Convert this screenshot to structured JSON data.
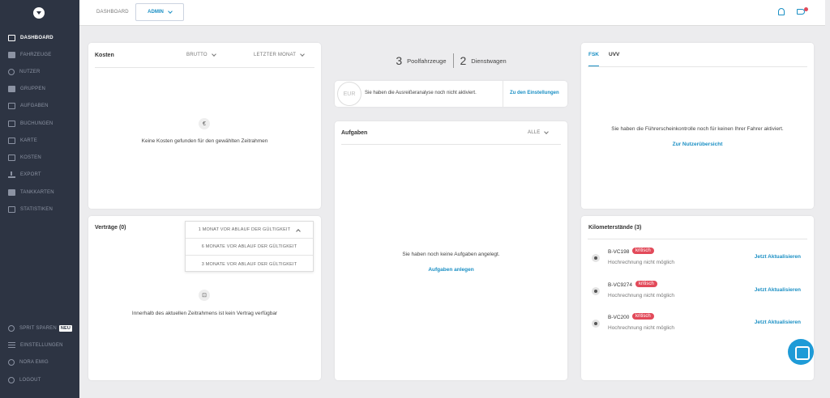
{
  "sidebar": {
    "items": [
      {
        "label": "DASHBOARD",
        "icon": "dashboard-icon"
      },
      {
        "label": "FAHRZEUGE",
        "icon": "car-icon"
      },
      {
        "label": "NUTZER",
        "icon": "user-icon"
      },
      {
        "label": "GRUPPEN",
        "icon": "group-icon"
      },
      {
        "label": "AUFGABEN",
        "icon": "clipboard-icon"
      },
      {
        "label": "BUCHUNGEN",
        "icon": "calendar-icon"
      },
      {
        "label": "KARTE",
        "icon": "map-icon"
      },
      {
        "label": "KOSTEN",
        "icon": "credit-card-icon"
      },
      {
        "label": "EXPORT",
        "icon": "download-icon"
      },
      {
        "label": "TANKKARTEN",
        "icon": "fuel-icon"
      },
      {
        "label": "STATISTIKEN",
        "icon": "chart-icon"
      }
    ],
    "bottom": [
      {
        "label": "SPRIT SPAREN",
        "badge": "NEU",
        "icon": "user-icon"
      },
      {
        "label": "EINSTELLUNGEN",
        "icon": "sliders-icon"
      },
      {
        "label": "NORA EMIG",
        "icon": "user-icon"
      },
      {
        "label": "LOGOUT",
        "icon": "power-icon"
      }
    ]
  },
  "header": {
    "breadcrumb": "DASHBOARD",
    "admin": "ADMIN"
  },
  "kosten": {
    "title": "Kosten",
    "brutto": "BRUTTO",
    "period": "LETZTER MONAT",
    "icon_char": "€",
    "empty": "Keine Kosten gefunden für den gewählten Zeitrahmen"
  },
  "vertraege": {
    "title": "Verträge (0)",
    "options": [
      "1 MONAT VOR ABLAUF DER GÜLTIGKEIT",
      "6 MONATE VOR ABLAUF DER GÜLTIGKEIT",
      "3 MONATE VOR ABLAUF DER GÜLTIGKEIT"
    ],
    "empty": "Innerhalb des aktuellen Zeitrahmens ist kein Vertrag verfügbar"
  },
  "fleet": {
    "pool_count": "3",
    "pool_label": "Poolfahrzeuge",
    "dienst_count": "2",
    "dienst_label": "Dienstwagen"
  },
  "eur": {
    "badge": "EUR",
    "text": "Sie haben die Ausreißeranalyse noch nicht aktiviert.",
    "link": "Zu den Einstellungen"
  },
  "aufgaben": {
    "title": "Aufgaben",
    "filter": "ALLE",
    "empty": "Sie haben noch keine Aufgaben angelegt.",
    "link": "Aufgaben anlegen"
  },
  "fsk": {
    "tab1": "FSK",
    "tab2": "UVV",
    "text": "Sie haben die Führerscheinkontrolle noch für keinen Ihrer Fahrer aktiviert.",
    "link": "Zur Nutzerübersicht"
  },
  "km": {
    "title": "Kilometerstände (3)",
    "rows": [
      {
        "plate": "B-VC198",
        "status": "kritisch",
        "note": "Hochrechnung nicht möglich",
        "action": "Jetzt Aktualisieren"
      },
      {
        "plate": "B-VC9274",
        "status": "kritisch",
        "note": "Hochrechnung nicht möglich",
        "action": "Jetzt Aktualisieren"
      },
      {
        "plate": "B-VC200",
        "status": "kritisch",
        "note": "Hochrechnung nicht möglich",
        "action": "Jetzt Aktualisieren"
      }
    ]
  },
  "colors": {
    "sidebar": "#2d3443",
    "accent": "#1a8fc4",
    "critical": "#e24a5a"
  }
}
